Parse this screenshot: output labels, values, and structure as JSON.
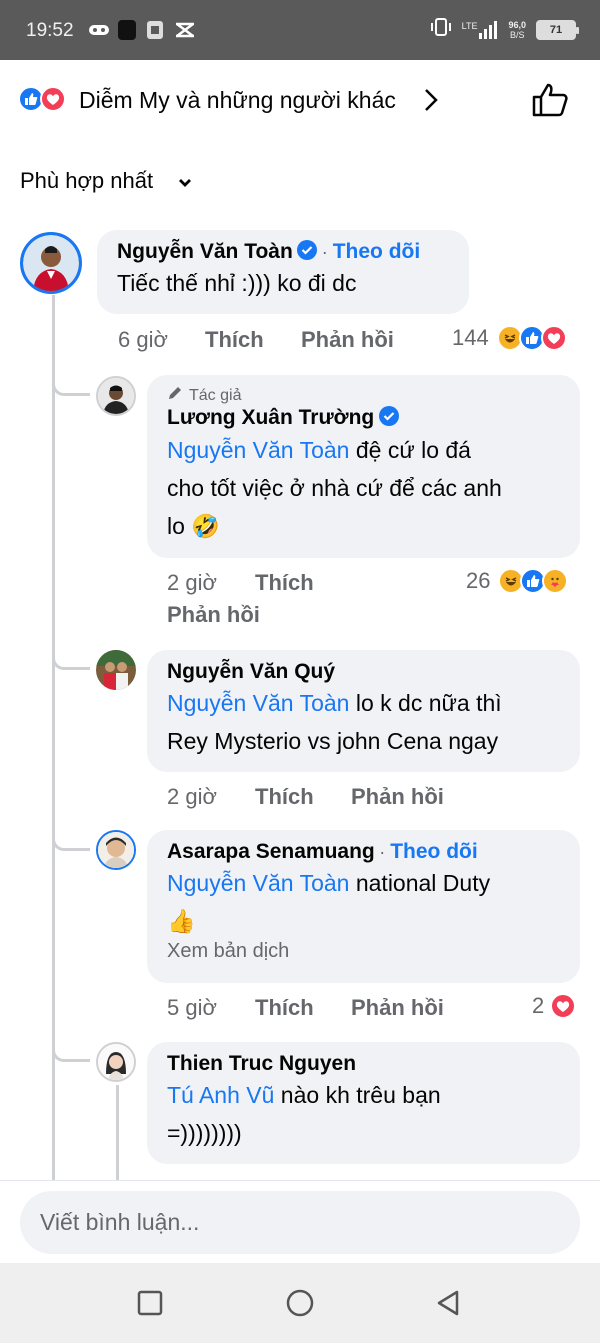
{
  "status_bar": {
    "time": "19:52",
    "network": "LTE",
    "speed_value": "96,0",
    "speed_unit": "B/S",
    "battery": "71"
  },
  "reactions_header": {
    "text": "Diễm My và những người khác",
    "icons": [
      "like-icon",
      "love-icon"
    ]
  },
  "sort": {
    "label": "Phù hợp nhất"
  },
  "comments": [
    {
      "author": "Nguyễn Văn Toàn",
      "verified": true,
      "follow_sep": " · ",
      "follow": "Theo dõi",
      "text": "Tiếc thế nhỉ :))) ko đi dc",
      "time": "6 giờ",
      "like": "Thích",
      "reply": "Phản hồi",
      "reaction_count": "144",
      "reactions": [
        "haha",
        "like",
        "love"
      ]
    },
    {
      "badge": "Tác giả",
      "author": "Lương Xuân Trường",
      "verified": true,
      "mention": "Nguyễn Văn Toàn",
      "text_line1": " đệ cứ lo đá",
      "text_line2": "cho tốt việc ở nhà cứ để các anh",
      "text_line3": "lo 🤣",
      "time": "2 giờ",
      "like": "Thích",
      "reply": "Phản hồi",
      "reaction_count": "26",
      "reactions": [
        "haha",
        "like",
        "care"
      ]
    },
    {
      "author": "Nguyễn Văn Quý",
      "mention": "Nguyễn Văn Toàn",
      "text_line1": " lo k dc nữa thì",
      "text_line2": "Rey Mysterio vs john Cena ngay",
      "time": "2 giờ",
      "like": "Thích",
      "reply": "Phản hồi"
    },
    {
      "author": "Asarapa Senamuang",
      "follow_sep": " · ",
      "follow": "Theo dõi",
      "mention": "Nguyễn Văn Toàn",
      "text_line1": " national Duty",
      "text_line2": "👍",
      "translate": "Xem bản dịch",
      "time": "5 giờ",
      "like": "Thích",
      "reply": "Phản hồi",
      "reaction_count": "2",
      "reactions": [
        "love"
      ]
    },
    {
      "author": "Thien Truc Nguyen",
      "mention": "Tú Anh Vũ",
      "text_line1": " nào kh trêu bạn",
      "text_line2": "=))))))))"
    }
  ],
  "composer": {
    "placeholder": "Viết bình luận..."
  },
  "nav": [
    "recents-button",
    "home-button",
    "back-button"
  ],
  "colors": {
    "accent": "#1877f2",
    "love": "#f33e58",
    "haha": "#f7b125",
    "bubble": "#f0f2f5",
    "meta": "#65676b"
  }
}
